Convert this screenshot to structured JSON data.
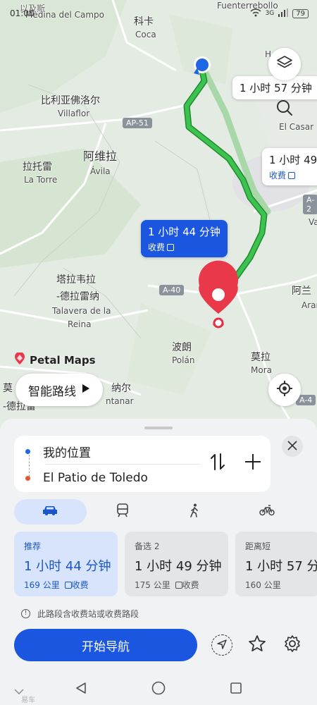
{
  "status": {
    "time": "01:00",
    "network": "3G",
    "battery": "79"
  },
  "map": {
    "places": {
      "medina": "Medina del Campo",
      "coca_cn": "科卡",
      "coca": "Coca",
      "villaflor_cn": "比利亚佛洛尔",
      "villaflor": "Villaflor",
      "avila_cn": "阿维拉",
      "avila": "Ávila",
      "latorre_cn": "拉托雷",
      "latorre": "La Torre",
      "talavera_cn1": "塔拉韦拉",
      "talavera_cn2": "-德拉雷纳",
      "talavera1": "Talavera de la",
      "talavera2": "Reina",
      "polan_cn": "波朗",
      "polan": "Polán",
      "mora_cn": "莫拉",
      "mora": "Mora",
      "fuenterrebollo": "Fuenterrebollo",
      "elcasar": "El Casar",
      "aran_cn": "阿兰",
      "aran": "Aran",
      "va": "Va",
      "hde": "H de",
      "left_cn1": "莫",
      "left_cn2": "-德拉雷",
      "left_cn3": "纳尔",
      "left_tar": "ntanar",
      "small_top": "以及斯"
    },
    "roads": {
      "ap51": "AP-51",
      "a40": "A-40",
      "a4": "A-4",
      "a2": "A-2"
    },
    "bubbles": {
      "alt1_time": "1 小时 57 分钟",
      "alt2_time": "1 小时 49",
      "alt2_toll": "收费",
      "sel_time": "1 小时 44 分钟",
      "sel_toll": "收费"
    },
    "brand": "Petal Maps",
    "smart_route": "智能路线"
  },
  "sheet": {
    "origin": "我的位置",
    "destination": "El Patio de Toledo",
    "modes": [
      "car-icon",
      "train-icon",
      "walk-icon",
      "bike-icon"
    ],
    "routes": [
      {
        "label": "推荐",
        "time": "1 小时 44 分钟",
        "distance": "169 公里",
        "toll": "收费"
      },
      {
        "label": "备选 2",
        "time": "1 小时 49 分钟",
        "distance": "175 公里",
        "toll": "收费"
      },
      {
        "label": "距离短",
        "time": "1 小时 57 分",
        "distance": "160 公里",
        "toll": ""
      }
    ],
    "notice": "此路段含收费站或收费路段",
    "start_label": "开始导航"
  },
  "watermark": "易车"
}
